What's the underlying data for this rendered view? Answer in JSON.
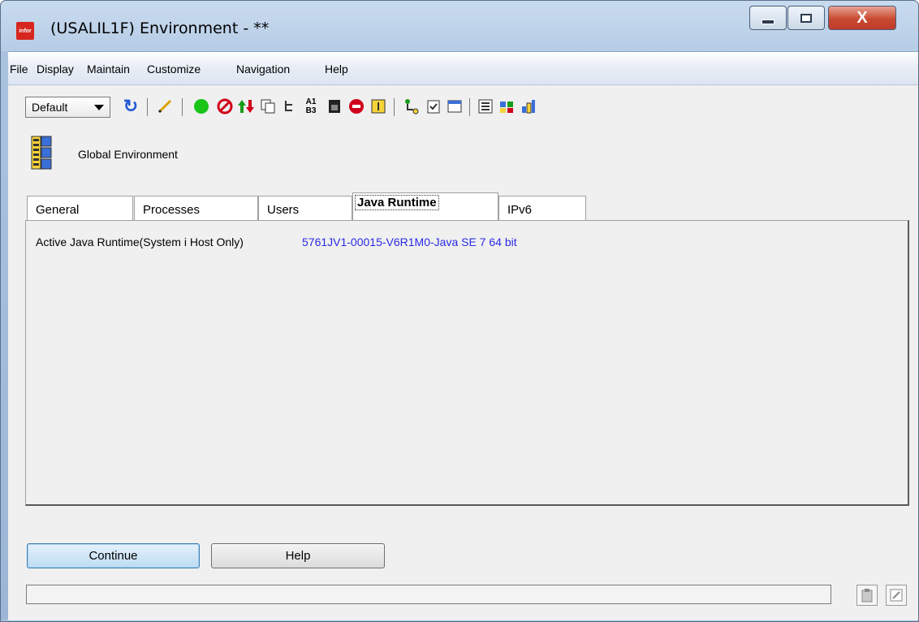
{
  "window": {
    "title": "(USALIL1F) Environment - **",
    "logo_text": "infor",
    "close_label": "X"
  },
  "menu": {
    "items": [
      "File",
      "Display",
      "Maintain",
      "Customize",
      "Navigation",
      "Help"
    ]
  },
  "toolbar": {
    "view_select": "Default",
    "icons": [
      "refresh-icon",
      "edit-pencil-icon",
      "green-circle-icon",
      "stop-icon",
      "up-down-arrows-icon",
      "copy-icon",
      "tree-icon",
      "a1-b3-icon",
      "document-icon",
      "red-blocked-icon",
      "info-icon",
      "hierarchy-icon",
      "clipboard-check-icon",
      "window-icon",
      "list-view-icon",
      "matrix-icon",
      "grid-blocks-icon"
    ]
  },
  "header": {
    "label": "Global Environment"
  },
  "tabs": [
    {
      "label": "General"
    },
    {
      "label": "Processes"
    },
    {
      "label": "Users"
    },
    {
      "label": "Java Runtime"
    },
    {
      "label": "IPv6"
    }
  ],
  "java_runtime": {
    "field_label": "Active Java Runtime(System i Host Only)",
    "field_value": "5761JV1-00015-V6R1M0-Java SE 7 64 bit"
  },
  "buttons": {
    "continue_label": "Continue",
    "help_label": "Help"
  },
  "status": {
    "text": ""
  },
  "colors": {
    "link_value": "#2a2ae6",
    "close_button": "#c84a31",
    "logo": "#d6261d"
  }
}
